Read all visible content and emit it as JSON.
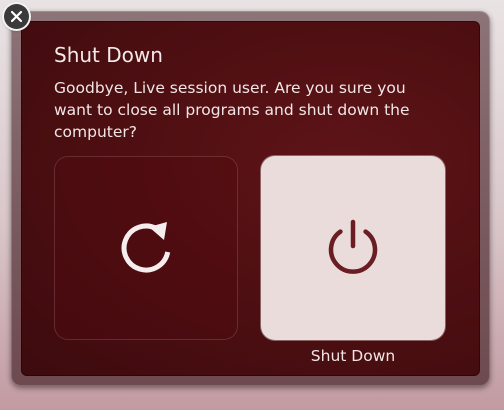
{
  "dialog": {
    "title": "Shut Down",
    "message": "Goodbye, Live session user. Are you sure you want to close all programs and shut down the computer?",
    "close_icon": "close-icon",
    "actions": [
      {
        "id": "restart",
        "icon": "restart-icon",
        "label": ""
      },
      {
        "id": "shutdown",
        "icon": "power-icon",
        "label": "Shut Down",
        "selected": true
      }
    ]
  },
  "colors": {
    "dialog_background": "#4f0f12",
    "selected_tile": "#ebdcdc",
    "icon_on_dark": "#f6eeee",
    "icon_on_light": "#6a1d22",
    "text": "#f1e6e6"
  }
}
